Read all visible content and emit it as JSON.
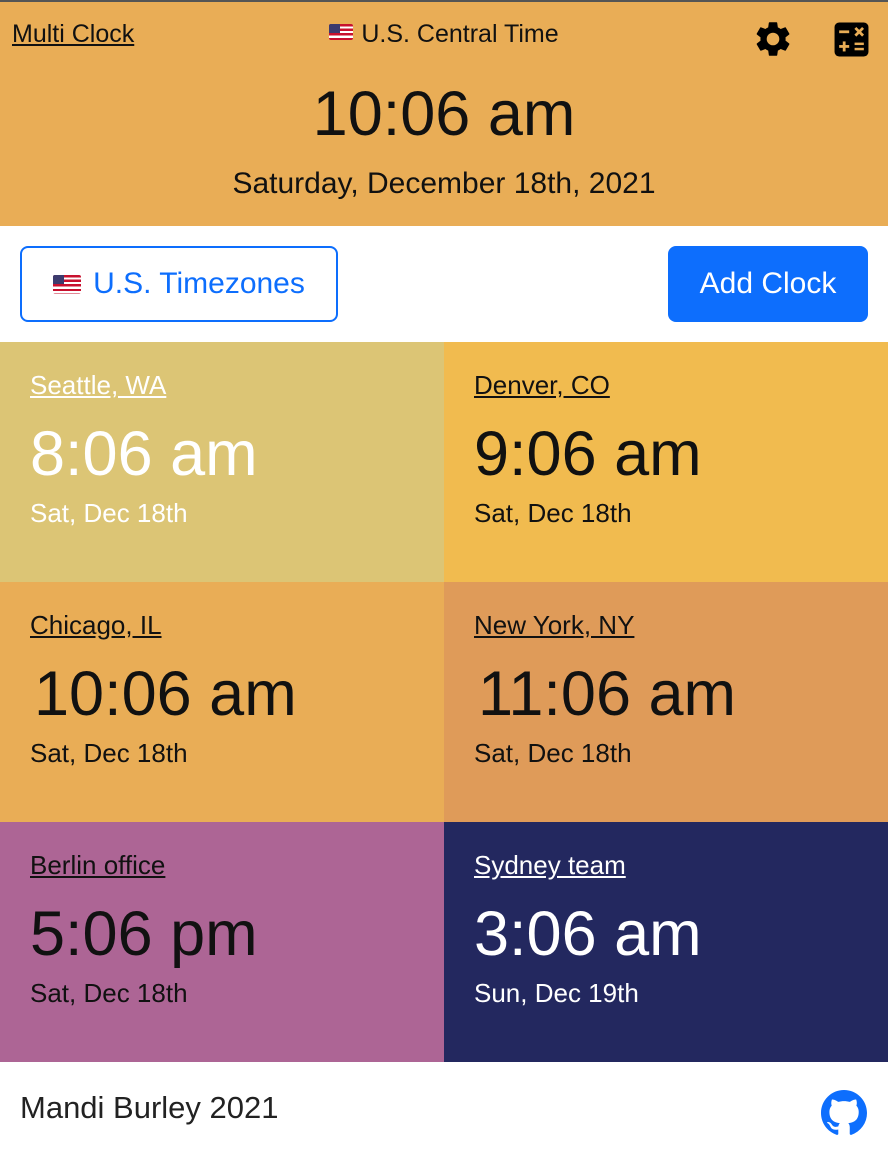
{
  "header": {
    "app_title": "Multi Clock",
    "local_zone_label": "U.S. Central Time",
    "main_time": "10:06 am",
    "main_date": "Saturday, December 18th, 2021",
    "background_color": "#e9ad56",
    "icons": [
      "settings-gear-icon",
      "calculator-icon",
      "us-flag-icon"
    ]
  },
  "toolbar": {
    "timezones_button_label": "U.S. Timezones",
    "add_clock_button_label": "Add Clock",
    "accent_color": "#0d6efd"
  },
  "clocks": [
    {
      "city": "Seattle, WA",
      "time": "8:06 am",
      "date": "Sat, Dec 18th",
      "color": "#dcc575"
    },
    {
      "city": "Denver, CO",
      "time": "9:06 am",
      "date": "Sat, Dec 18th",
      "color": "#f1bb4f"
    },
    {
      "city": "Chicago, IL",
      "time": "10:06 am",
      "date": "Sat, Dec 18th",
      "color": "#e9ad56"
    },
    {
      "city": "New York, NY",
      "time": "11:06 am",
      "date": "Sat, Dec 18th",
      "color": "#df9b59"
    },
    {
      "city": "Berlin office",
      "time": "5:06 pm",
      "date": "Sat, Dec 18th",
      "color": "#ad6595"
    },
    {
      "city": "Sydney team",
      "time": "3:06 am",
      "date": "Sun, Dec 19th",
      "color": "#23285f"
    }
  ],
  "footer": {
    "credit": "Mandi Burley 2021",
    "github_icon": "github-icon"
  }
}
